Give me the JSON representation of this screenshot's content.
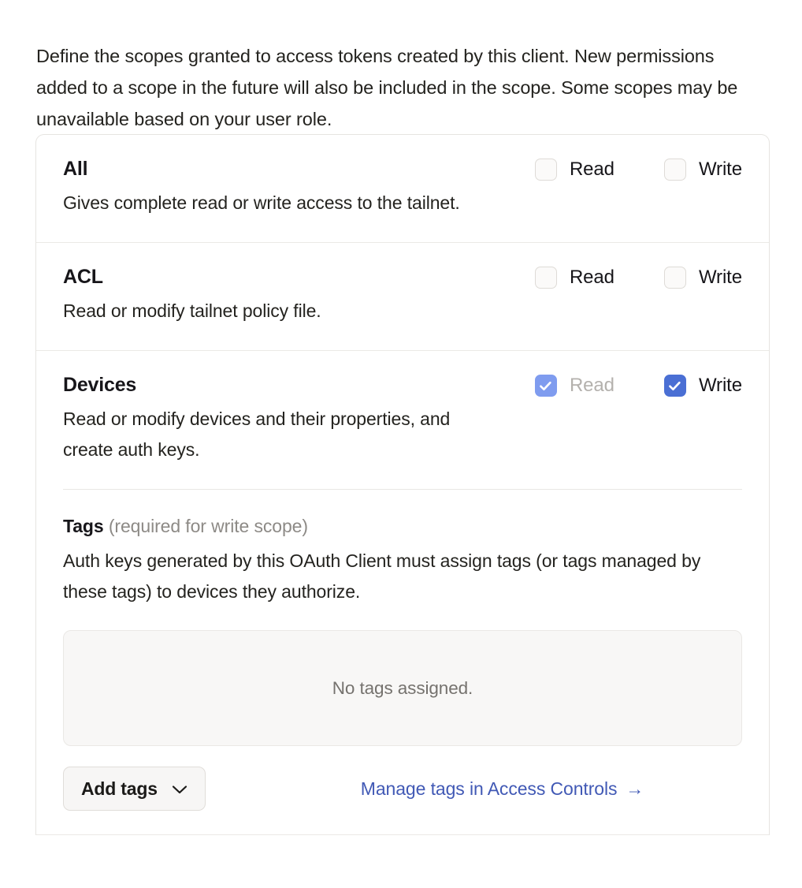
{
  "intro": {
    "text": "Define the scopes granted to access tokens created by this client. New permissions added to a scope in the future will also be included in the scope. Some scopes may be unavailable based on your user role."
  },
  "colors": {
    "accent_checked": "#4a6fd4",
    "accent_checked_muted": "#7f9cef",
    "link": "#4159b5",
    "card_border": "#e6e4e1",
    "empty_box_bg": "#f8f7f6",
    "muted_text": "#8d8a86"
  },
  "scopes": [
    {
      "title": "All",
      "description": "Gives complete read or write access to the tailnet.",
      "permissions": [
        {
          "label": "Read",
          "checked": false,
          "disabled": false
        },
        {
          "label": "Write",
          "checked": false,
          "disabled": false
        }
      ]
    },
    {
      "title": "ACL",
      "description": "Read or modify tailnet policy file.",
      "permissions": [
        {
          "label": "Read",
          "checked": false,
          "disabled": false
        },
        {
          "label": "Write",
          "checked": false,
          "disabled": false
        }
      ]
    },
    {
      "title": "Devices",
      "description": "Read or modify devices and their properties, and create auth keys.",
      "permissions": [
        {
          "label": "Read",
          "checked": true,
          "disabled": true
        },
        {
          "label": "Write",
          "checked": true,
          "disabled": false
        }
      ]
    }
  ],
  "tags": {
    "heading": "Tags",
    "heading_hint": "(required for write scope)",
    "description": "Auth keys generated by this OAuth Client must assign tags (or tags managed by these tags) to devices they authorize.",
    "empty_message": "No tags assigned.",
    "add_button_label": "Add tags",
    "manage_link_label": "Manage tags in Access Controls",
    "manage_link_arrow": "→"
  }
}
